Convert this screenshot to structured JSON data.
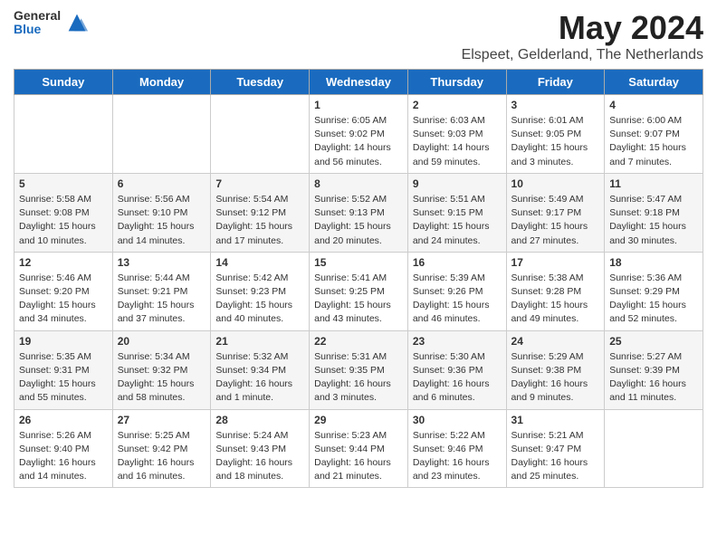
{
  "header": {
    "logo_general": "General",
    "logo_blue": "Blue",
    "month_title": "May 2024",
    "subtitle": "Elspeet, Gelderland, The Netherlands"
  },
  "weekdays": [
    "Sunday",
    "Monday",
    "Tuesday",
    "Wednesday",
    "Thursday",
    "Friday",
    "Saturday"
  ],
  "weeks": [
    [
      {
        "day": "",
        "info": ""
      },
      {
        "day": "",
        "info": ""
      },
      {
        "day": "",
        "info": ""
      },
      {
        "day": "1",
        "info": "Sunrise: 6:05 AM\nSunset: 9:02 PM\nDaylight: 14 hours and 56 minutes."
      },
      {
        "day": "2",
        "info": "Sunrise: 6:03 AM\nSunset: 9:03 PM\nDaylight: 14 hours and 59 minutes."
      },
      {
        "day": "3",
        "info": "Sunrise: 6:01 AM\nSunset: 9:05 PM\nDaylight: 15 hours and 3 minutes."
      },
      {
        "day": "4",
        "info": "Sunrise: 6:00 AM\nSunset: 9:07 PM\nDaylight: 15 hours and 7 minutes."
      }
    ],
    [
      {
        "day": "5",
        "info": "Sunrise: 5:58 AM\nSunset: 9:08 PM\nDaylight: 15 hours and 10 minutes."
      },
      {
        "day": "6",
        "info": "Sunrise: 5:56 AM\nSunset: 9:10 PM\nDaylight: 15 hours and 14 minutes."
      },
      {
        "day": "7",
        "info": "Sunrise: 5:54 AM\nSunset: 9:12 PM\nDaylight: 15 hours and 17 minutes."
      },
      {
        "day": "8",
        "info": "Sunrise: 5:52 AM\nSunset: 9:13 PM\nDaylight: 15 hours and 20 minutes."
      },
      {
        "day": "9",
        "info": "Sunrise: 5:51 AM\nSunset: 9:15 PM\nDaylight: 15 hours and 24 minutes."
      },
      {
        "day": "10",
        "info": "Sunrise: 5:49 AM\nSunset: 9:17 PM\nDaylight: 15 hours and 27 minutes."
      },
      {
        "day": "11",
        "info": "Sunrise: 5:47 AM\nSunset: 9:18 PM\nDaylight: 15 hours and 30 minutes."
      }
    ],
    [
      {
        "day": "12",
        "info": "Sunrise: 5:46 AM\nSunset: 9:20 PM\nDaylight: 15 hours and 34 minutes."
      },
      {
        "day": "13",
        "info": "Sunrise: 5:44 AM\nSunset: 9:21 PM\nDaylight: 15 hours and 37 minutes."
      },
      {
        "day": "14",
        "info": "Sunrise: 5:42 AM\nSunset: 9:23 PM\nDaylight: 15 hours and 40 minutes."
      },
      {
        "day": "15",
        "info": "Sunrise: 5:41 AM\nSunset: 9:25 PM\nDaylight: 15 hours and 43 minutes."
      },
      {
        "day": "16",
        "info": "Sunrise: 5:39 AM\nSunset: 9:26 PM\nDaylight: 15 hours and 46 minutes."
      },
      {
        "day": "17",
        "info": "Sunrise: 5:38 AM\nSunset: 9:28 PM\nDaylight: 15 hours and 49 minutes."
      },
      {
        "day": "18",
        "info": "Sunrise: 5:36 AM\nSunset: 9:29 PM\nDaylight: 15 hours and 52 minutes."
      }
    ],
    [
      {
        "day": "19",
        "info": "Sunrise: 5:35 AM\nSunset: 9:31 PM\nDaylight: 15 hours and 55 minutes."
      },
      {
        "day": "20",
        "info": "Sunrise: 5:34 AM\nSunset: 9:32 PM\nDaylight: 15 hours and 58 minutes."
      },
      {
        "day": "21",
        "info": "Sunrise: 5:32 AM\nSunset: 9:34 PM\nDaylight: 16 hours and 1 minute."
      },
      {
        "day": "22",
        "info": "Sunrise: 5:31 AM\nSunset: 9:35 PM\nDaylight: 16 hours and 3 minutes."
      },
      {
        "day": "23",
        "info": "Sunrise: 5:30 AM\nSunset: 9:36 PM\nDaylight: 16 hours and 6 minutes."
      },
      {
        "day": "24",
        "info": "Sunrise: 5:29 AM\nSunset: 9:38 PM\nDaylight: 16 hours and 9 minutes."
      },
      {
        "day": "25",
        "info": "Sunrise: 5:27 AM\nSunset: 9:39 PM\nDaylight: 16 hours and 11 minutes."
      }
    ],
    [
      {
        "day": "26",
        "info": "Sunrise: 5:26 AM\nSunset: 9:40 PM\nDaylight: 16 hours and 14 minutes."
      },
      {
        "day": "27",
        "info": "Sunrise: 5:25 AM\nSunset: 9:42 PM\nDaylight: 16 hours and 16 minutes."
      },
      {
        "day": "28",
        "info": "Sunrise: 5:24 AM\nSunset: 9:43 PM\nDaylight: 16 hours and 18 minutes."
      },
      {
        "day": "29",
        "info": "Sunrise: 5:23 AM\nSunset: 9:44 PM\nDaylight: 16 hours and 21 minutes."
      },
      {
        "day": "30",
        "info": "Sunrise: 5:22 AM\nSunset: 9:46 PM\nDaylight: 16 hours and 23 minutes."
      },
      {
        "day": "31",
        "info": "Sunrise: 5:21 AM\nSunset: 9:47 PM\nDaylight: 16 hours and 25 minutes."
      },
      {
        "day": "",
        "info": ""
      }
    ]
  ]
}
